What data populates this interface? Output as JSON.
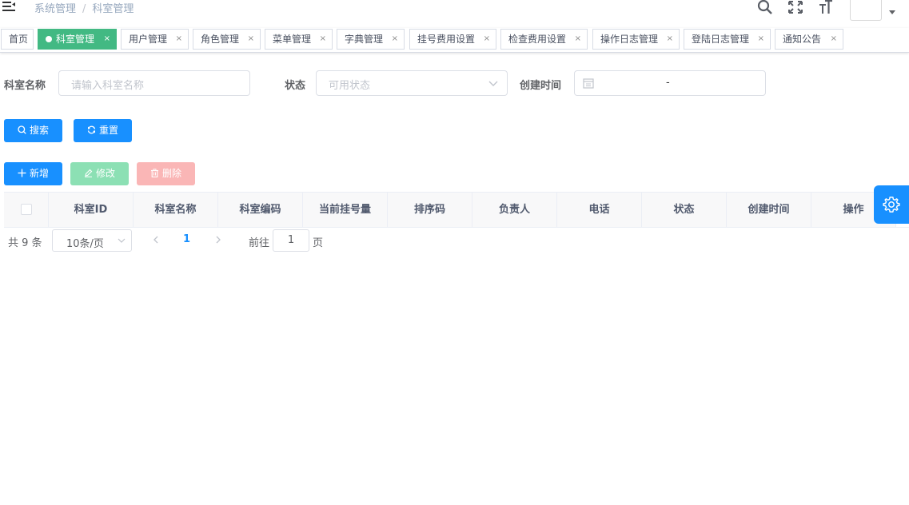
{
  "breadcrumb": {
    "items": [
      "系统管理",
      "科室管理"
    ],
    "separator": "/"
  },
  "tags": [
    {
      "label": "首页",
      "closable": false,
      "active": false
    },
    {
      "label": "科室管理",
      "closable": true,
      "active": true
    },
    {
      "label": "用户管理",
      "closable": true,
      "active": false
    },
    {
      "label": "角色管理",
      "closable": true,
      "active": false
    },
    {
      "label": "菜单管理",
      "closable": true,
      "active": false
    },
    {
      "label": "字典管理",
      "closable": true,
      "active": false
    },
    {
      "label": "挂号费用设置",
      "closable": true,
      "active": false
    },
    {
      "label": "检查费用设置",
      "closable": true,
      "active": false
    },
    {
      "label": "操作日志管理",
      "closable": true,
      "active": false
    },
    {
      "label": "登陆日志管理",
      "closable": true,
      "active": false
    },
    {
      "label": "通知公告",
      "closable": true,
      "active": false
    }
  ],
  "tag_close_glyph": "×",
  "search_form": {
    "dept_name_label": "科室名称",
    "dept_name_placeholder": "请输入科室名称",
    "status_label": "状态",
    "status_placeholder": "可用状态",
    "create_time_label": "创建时间",
    "date_range_separator": "-"
  },
  "buttons": {
    "search": "搜索",
    "reset": "重置",
    "add": "新增",
    "edit": "修改",
    "delete": "删除"
  },
  "table": {
    "columns": [
      "科室ID",
      "科室名称",
      "科室编码",
      "当前挂号量",
      "排序码",
      "负责人",
      "电话",
      "状态",
      "创建时间",
      "操作"
    ],
    "rows": []
  },
  "pagination": {
    "total_text": "共 9 条",
    "page_size": "10条/页",
    "current_page": "1",
    "goto_label": "前往",
    "goto_value": "1",
    "page_suffix": "页"
  },
  "icons": {
    "menu": "hamburger-icon",
    "search": "search-icon",
    "fullscreen": "fullscreen-icon",
    "size": "font-size-icon",
    "settings": "gear-icon"
  },
  "colors": {
    "primary": "#1890ff",
    "active_tag": "#42b983",
    "success_disabled": "#8ce0b4",
    "danger_disabled": "#fab6b6"
  }
}
